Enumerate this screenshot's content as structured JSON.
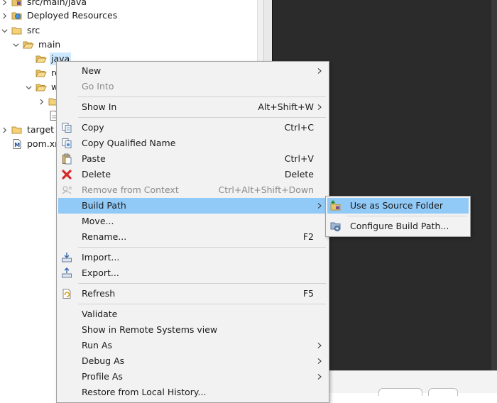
{
  "tree": {
    "items": [
      {
        "label": "src/main/java",
        "icon": "source-folder-icon",
        "expander": "right"
      },
      {
        "label": "Deployed Resources",
        "icon": "deployed-resources-icon",
        "expander": "right"
      },
      {
        "label": "src",
        "icon": "folder-icon",
        "expander": "down"
      },
      {
        "label": "main",
        "icon": "folder-icon",
        "expander": "down"
      },
      {
        "label": "java",
        "icon": "folder-icon",
        "expander": "none",
        "selected": true
      },
      {
        "label": "re",
        "icon": "folder-icon",
        "expander": "none"
      },
      {
        "label": "w",
        "icon": "folder-icon",
        "expander": "down"
      },
      {
        "label": "",
        "icon": "folder-icon",
        "expander": "right"
      },
      {
        "label": "",
        "icon": "file-icon",
        "expander": "none"
      },
      {
        "label": "target",
        "icon": "folder-icon",
        "expander": "right"
      },
      {
        "label": "pom.xm",
        "icon": "maven-pom-icon",
        "expander": "none"
      }
    ]
  },
  "context_menu": {
    "items": [
      {
        "label": "New",
        "submenu": true
      },
      {
        "label": "Go Into",
        "disabled": true
      },
      {
        "label": "Show In",
        "shortcut": "Alt+Shift+W",
        "submenu": true
      },
      {
        "label": "Copy",
        "shortcut": "Ctrl+C",
        "icon": "copy-icon"
      },
      {
        "label": "Copy Qualified Name",
        "icon": "copy-qualified-name-icon"
      },
      {
        "label": "Paste",
        "shortcut": "Ctrl+V",
        "icon": "paste-icon"
      },
      {
        "label": "Delete",
        "shortcut": "Delete",
        "icon": "delete-icon"
      },
      {
        "label": "Remove from Context",
        "shortcut": "Ctrl+Alt+Shift+Down",
        "icon": "remove-context-icon",
        "disabled": true
      },
      {
        "label": "Build Path",
        "submenu": true,
        "highlighted": true
      },
      {
        "label": "Move..."
      },
      {
        "label": "Rename...",
        "shortcut": "F2"
      },
      {
        "label": "Import...",
        "icon": "import-icon"
      },
      {
        "label": "Export...",
        "icon": "export-icon"
      },
      {
        "label": "Refresh",
        "shortcut": "F5",
        "icon": "refresh-icon"
      },
      {
        "label": "Validate"
      },
      {
        "label": "Show in Remote Systems view"
      },
      {
        "label": "Run As",
        "submenu": true
      },
      {
        "label": "Debug As",
        "submenu": true
      },
      {
        "label": "Profile As",
        "submenu": true
      },
      {
        "label": "Restore from Local History..."
      }
    ]
  },
  "build_path_submenu": {
    "items": [
      {
        "label": "Use as Source Folder",
        "icon": "source-folder-add-icon",
        "highlighted": true
      },
      {
        "label": "Configure Build Path...",
        "icon": "configure-build-path-icon"
      }
    ]
  },
  "colors": {
    "menu_highlight": "#91c9f7",
    "tree_selection": "#cce8ff",
    "editor_background": "#2b2b2b"
  }
}
